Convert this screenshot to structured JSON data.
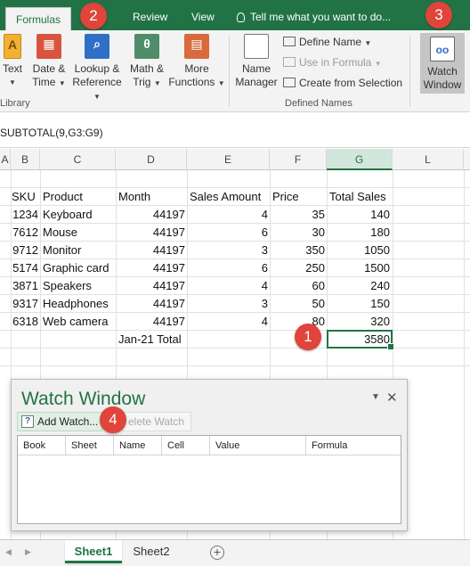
{
  "tabs": {
    "formulas": "Formulas",
    "review": "Review",
    "view": "View",
    "tell_me": "Tell me what you want to do..."
  },
  "ribbon": {
    "function_library": {
      "text_line1": "Text",
      "date_line1": "Date &",
      "date_line2": "Time",
      "lookup_line1": "Lookup &",
      "lookup_line2": "Reference",
      "math_line1": "Math &",
      "math_line2": "Trig",
      "more_line1": "More",
      "more_line2": "Functions",
      "group_label": "Library"
    },
    "defined_names": {
      "name_manager_line1": "Name",
      "name_manager_line2": "Manager",
      "define_name": "Define Name",
      "use_in_formula": "Use in Formula",
      "create_from_selection": "Create from Selection",
      "group_label": "Defined Names"
    },
    "watch_window_line1": "Watch",
    "watch_window_line2": "Window"
  },
  "formula_bar": {
    "formula": "SUBTOTAL(9,G3:G9)"
  },
  "columns": [
    "A",
    "B",
    "C",
    "D",
    "E",
    "F",
    "G",
    "L"
  ],
  "table": {
    "headers": [
      "SKU",
      "Product",
      "Month",
      "Sales Amount",
      "Price",
      "Total Sales"
    ],
    "rows": [
      [
        "1234",
        "Keyboard",
        "44197",
        "4",
        "35",
        "140"
      ],
      [
        "7612",
        "Mouse",
        "44197",
        "6",
        "30",
        "180"
      ],
      [
        "9712",
        "Monitor",
        "44197",
        "3",
        "350",
        "1050"
      ],
      [
        "5174",
        "Graphic card",
        "44197",
        "6",
        "250",
        "1500"
      ],
      [
        "3871",
        "Speakers",
        "44197",
        "4",
        "60",
        "240"
      ],
      [
        "9317",
        "Headphones",
        "44197",
        "3",
        "50",
        "150"
      ],
      [
        "6318",
        "Web camera",
        "44197",
        "4",
        "80",
        "320"
      ]
    ],
    "total_label": "Jan-21 Total",
    "total_value": "3580"
  },
  "watch_window": {
    "title": "Watch Window",
    "add_watch": "Add Watch...",
    "delete_watch": "elete Watch",
    "columns": [
      "Book",
      "Sheet",
      "Name",
      "Cell",
      "Value",
      "Formula"
    ]
  },
  "callouts": [
    "1",
    "2",
    "3",
    "4"
  ],
  "sheets": [
    "Sheet1",
    "Sheet2"
  ],
  "colors": {
    "excel_green": "#217346",
    "callout_red": "#e0443a"
  }
}
